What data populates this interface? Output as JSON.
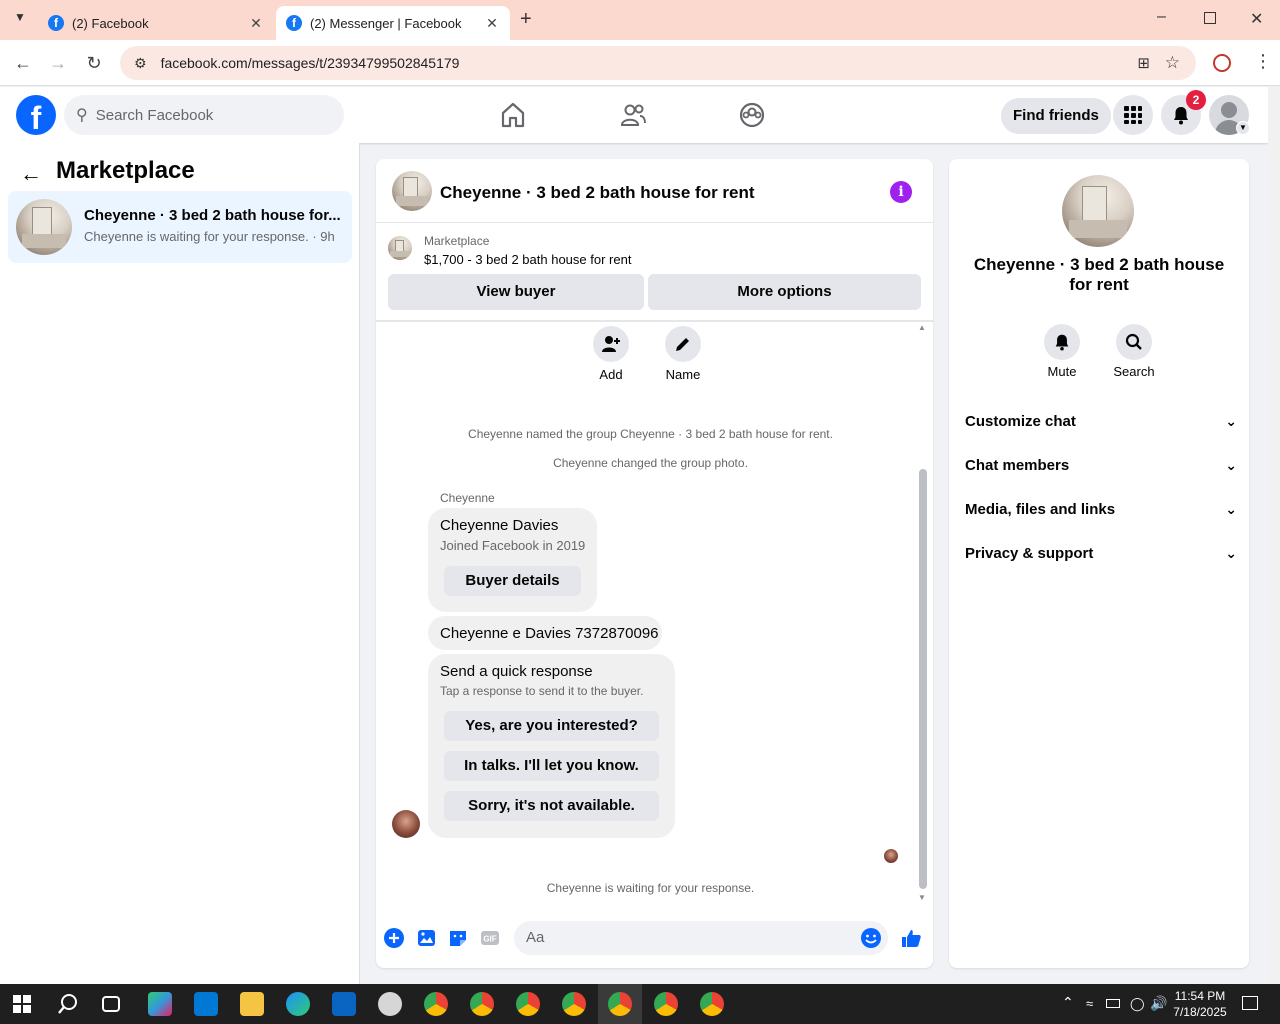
{
  "browser": {
    "tabs": [
      {
        "title": "(2) Facebook"
      },
      {
        "title": "(2) Messenger | Facebook"
      }
    ],
    "url": "facebook.com/messages/t/23934799502845179"
  },
  "header": {
    "search_placeholder": "Search Facebook",
    "find_friends": "Find friends",
    "notification_count": "2"
  },
  "left": {
    "title": "Marketplace",
    "conversation": {
      "name": "Cheyenne · 3 bed 2 bath house for...",
      "preview": "Cheyenne is waiting for your response. · 9h"
    }
  },
  "chat": {
    "title": "Cheyenne · 3 bed 2 bath house for rent",
    "marketplace_label": "Marketplace",
    "listing": "$1,700 - 3 bed 2 bath house for rent",
    "view_buyer": "View buyer",
    "more_options": "More options",
    "add_label": "Add",
    "name_label": "Name",
    "system_msg_1": "Cheyenne named the group Cheyenne · 3 bed 2 bath house for rent.",
    "system_msg_2": "Cheyenne changed the group photo.",
    "sender": "Cheyenne",
    "card_name": "Cheyenne Davies",
    "card_sub": "Joined Facebook in 2019",
    "buyer_details": "Buyer details",
    "message": "Cheyenne e Davies 7372870096",
    "quick_title": "Send a quick response",
    "quick_sub": "Tap a response to send it to the buyer.",
    "quick_responses": [
      "Yes, are you interested?",
      "In talks. I'll let you know.",
      "Sorry, it's not available."
    ],
    "waiting": "Cheyenne is waiting for your response.",
    "compose_placeholder": "Aa"
  },
  "right": {
    "title": "Cheyenne · 3 bed 2 bath house for rent",
    "mute": "Mute",
    "search": "Search",
    "sections": [
      "Customize chat",
      "Chat members",
      "Media, files and links",
      "Privacy & support"
    ]
  },
  "taskbar": {
    "time": "11:54 PM",
    "date": "7/18/2025"
  },
  "colors": {
    "brand": "#0866ff",
    "accent": "#a020f0",
    "badge": "#e41e3f"
  }
}
